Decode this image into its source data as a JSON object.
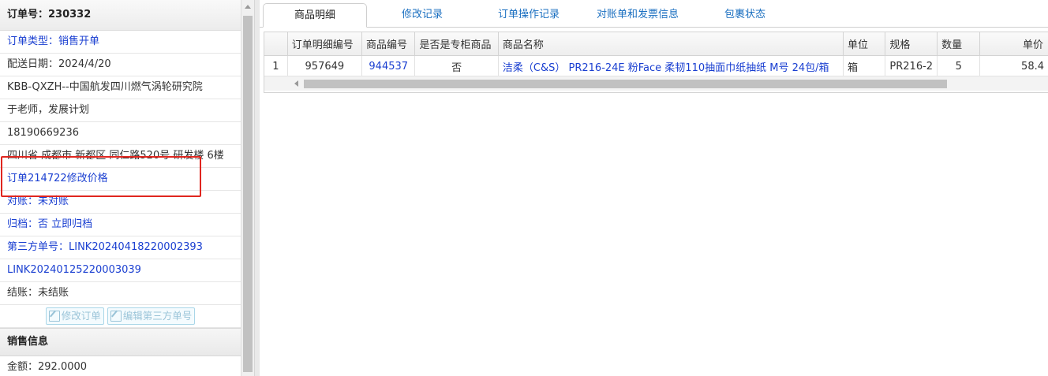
{
  "left_panel": {
    "order_no": "订单号：230332",
    "rows": [
      {
        "text": "订单类型：销售开单",
        "color": "blue"
      },
      {
        "text": "配送日期：2024/4/20",
        "color": "dark"
      },
      {
        "text": "KBB-QXZH--中国航发四川燃气涡轮研究院",
        "color": "dark"
      },
      {
        "text": "于老师，发展计划",
        "color": "dark"
      },
      {
        "text": "18190669236",
        "color": "dark"
      },
      {
        "text": "四川省 成都市 新都区 同仁路520号 研发楼 6楼",
        "color": "dark"
      },
      {
        "text": "订单214722修改价格",
        "color": "blue"
      },
      {
        "text": "对账：未对账",
        "color": "blue"
      },
      {
        "text": "归档：否 立即归档",
        "color": "blue"
      },
      {
        "text": "第三方单号：LINK20240418220002393",
        "color": "blue"
      },
      {
        "text": "LINK20240125220003039",
        "color": "blue"
      },
      {
        "text": "结账：未结账",
        "color": "dark"
      }
    ],
    "buttons": {
      "edit_order": "修改订单",
      "edit_third_party": "编辑第三方单号"
    },
    "sales_section_title": "销售信息",
    "amount": "金额：292.0000"
  },
  "tabs": [
    "商品明细",
    "修改记录",
    "订单操作记录",
    "对账单和发票信息",
    "包裹状态"
  ],
  "table": {
    "columns": [
      "",
      "订单明细编号",
      "商品编号",
      "是否是专柜商品",
      "商品名称",
      "单位",
      "规格",
      "数量",
      "单价"
    ],
    "rows": [
      [
        "1",
        "957649",
        "944537",
        "否",
        "洁柔（C&S） PR216-24E 粉Face 柔韧110抽面巾纸抽纸 M号 24包/箱",
        "箱",
        "PR216-2",
        "5",
        "58.4"
      ]
    ]
  },
  "colors": {
    "link_blue": "#1a3fd1",
    "tab_blue": "#1a6fc0",
    "highlight_red": "#e0261f"
  }
}
